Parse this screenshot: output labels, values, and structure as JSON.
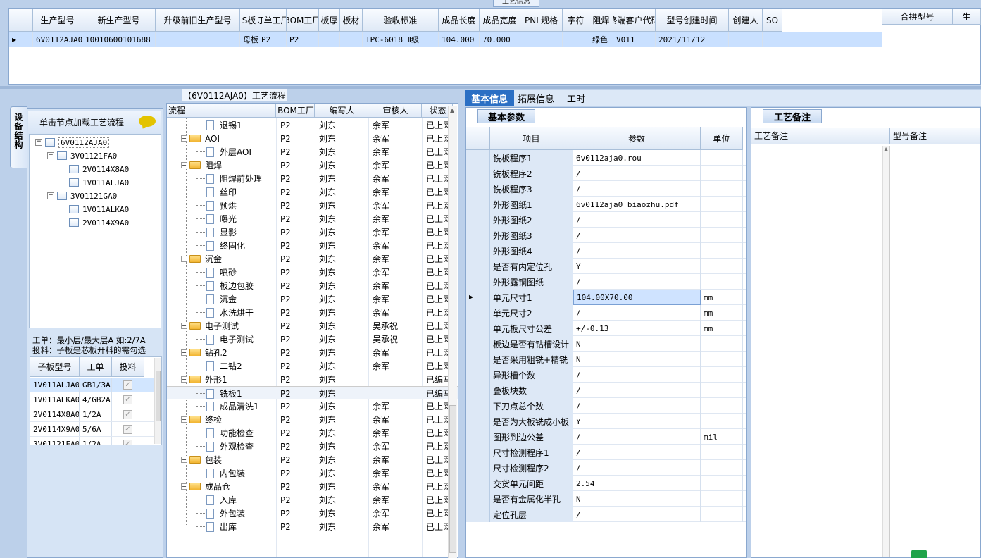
{
  "top_caption": "工艺信息",
  "top_grid": {
    "columns": [
      "生产型号",
      "新生产型号",
      "升级前旧生产型号",
      "S板",
      "订单工厂",
      "BOM工厂",
      "板厚",
      "板材",
      "验收标准",
      "成品长度",
      "成品宽度",
      "PNL规格",
      "字符",
      "阻焊",
      "终端客户代码",
      "型号创建时间",
      "创建人",
      "SO"
    ],
    "row": [
      "6V0112AJA0",
      "10010600101688",
      "",
      "母板",
      "P2",
      "P2",
      "",
      "",
      "IPC-6018 Ⅱ级",
      "104.000",
      "70.000",
      "",
      "",
      "绿色",
      "V011",
      "2021/11/12",
      "",
      ""
    ],
    "merge_columns": [
      "合拼型号",
      "生"
    ]
  },
  "side_tab": "设备结构",
  "left": {
    "load_hint": "单击节点加载工艺流程",
    "tree": [
      {
        "label": "6V0112AJA0",
        "level": 0,
        "toggle": "−"
      },
      {
        "label": "3V01121FA0",
        "level": 1,
        "toggle": "−"
      },
      {
        "label": "2V0114X8A0",
        "level": 2,
        "toggle": ""
      },
      {
        "label": "1V011ALJA0",
        "level": 2,
        "toggle": ""
      },
      {
        "label": "3V01121GA0",
        "level": 1,
        "toggle": "−"
      },
      {
        "label": "1V011ALKA0",
        "level": 2,
        "toggle": ""
      },
      {
        "label": "2V0114X9A0",
        "level": 2,
        "toggle": ""
      }
    ],
    "note_line1": "工单：最小层/最大层A 如:2/7A",
    "note_line2": "投料：子板是芯板开料的需勾选",
    "sub_grid": {
      "columns": [
        "子板型号",
        "工单",
        "投料"
      ],
      "rows": [
        [
          "1V011ALJA0",
          "GB1/3A",
          "✓"
        ],
        [
          "1V011ALKA0",
          "4/GB2A",
          "✓"
        ],
        [
          "2V0114X8A0",
          "1/2A",
          "✓"
        ],
        [
          "2V0114X9A0",
          "5/6A",
          "✓"
        ],
        [
          "3V01121FA0",
          "1/2A",
          "✓"
        ]
      ]
    }
  },
  "flow": {
    "title": "【6V0112AJA0】工艺流程",
    "columns": [
      "流程",
      "BOM工厂",
      "编写人",
      "审核人",
      "状态"
    ],
    "rows": [
      {
        "label": "退锡1",
        "level": 1,
        "factory": "P2",
        "writer": "刘东",
        "auditor": "余军",
        "status": "已上网"
      },
      {
        "label": "AOI",
        "level": 0,
        "factory": "P2",
        "writer": "刘东",
        "auditor": "余军",
        "status": "已上网"
      },
      {
        "label": "外层AOI",
        "level": 1,
        "factory": "P2",
        "writer": "刘东",
        "auditor": "余军",
        "status": "已上网"
      },
      {
        "label": "阻焊",
        "level": 0,
        "factory": "P2",
        "writer": "刘东",
        "auditor": "余军",
        "status": "已上网"
      },
      {
        "label": "阻焊前处理",
        "level": 1,
        "factory": "P2",
        "writer": "刘东",
        "auditor": "余军",
        "status": "已上网"
      },
      {
        "label": "丝印",
        "level": 1,
        "factory": "P2",
        "writer": "刘东",
        "auditor": "余军",
        "status": "已上网"
      },
      {
        "label": "预烘",
        "level": 1,
        "factory": "P2",
        "writer": "刘东",
        "auditor": "余军",
        "status": "已上网"
      },
      {
        "label": "曝光",
        "level": 1,
        "factory": "P2",
        "writer": "刘东",
        "auditor": "余军",
        "status": "已上网"
      },
      {
        "label": "显影",
        "level": 1,
        "factory": "P2",
        "writer": "刘东",
        "auditor": "余军",
        "status": "已上网"
      },
      {
        "label": "终固化",
        "level": 1,
        "factory": "P2",
        "writer": "刘东",
        "auditor": "余军",
        "status": "已上网"
      },
      {
        "label": "沉金",
        "level": 0,
        "factory": "P2",
        "writer": "刘东",
        "auditor": "余军",
        "status": "已上网"
      },
      {
        "label": "喷砂",
        "level": 1,
        "factory": "P2",
        "writer": "刘东",
        "auditor": "余军",
        "status": "已上网"
      },
      {
        "label": "板边包胶",
        "level": 1,
        "factory": "P2",
        "writer": "刘东",
        "auditor": "余军",
        "status": "已上网"
      },
      {
        "label": "沉金",
        "level": 1,
        "factory": "P2",
        "writer": "刘东",
        "auditor": "余军",
        "status": "已上网"
      },
      {
        "label": "水洗烘干",
        "level": 1,
        "factory": "P2",
        "writer": "刘东",
        "auditor": "余军",
        "status": "已上网"
      },
      {
        "label": "电子测试",
        "level": 0,
        "factory": "P2",
        "writer": "刘东",
        "auditor": "吴承祝",
        "status": "已上网"
      },
      {
        "label": "电子测试",
        "level": 1,
        "factory": "P2",
        "writer": "刘东",
        "auditor": "吴承祝",
        "status": "已上网"
      },
      {
        "label": "钻孔2",
        "level": 0,
        "factory": "P2",
        "writer": "刘东",
        "auditor": "余军",
        "status": "已上网"
      },
      {
        "label": "二钻2",
        "level": 1,
        "factory": "P2",
        "writer": "刘东",
        "auditor": "余军",
        "status": "已上网"
      },
      {
        "label": "外形1",
        "level": 0,
        "factory": "P2",
        "writer": "刘东",
        "auditor": "",
        "status": "已编写"
      },
      {
        "label": "铣板1",
        "level": 1,
        "factory": "P2",
        "writer": "刘东",
        "auditor": "",
        "status": "已编写"
      },
      {
        "label": "成品清洗1",
        "level": 1,
        "factory": "P2",
        "writer": "刘东",
        "auditor": "余军",
        "status": "已上网"
      },
      {
        "label": "终检",
        "level": 0,
        "factory": "P2",
        "writer": "刘东",
        "auditor": "余军",
        "status": "已上网"
      },
      {
        "label": "功能检查",
        "level": 1,
        "factory": "P2",
        "writer": "刘东",
        "auditor": "余军",
        "status": "已上网"
      },
      {
        "label": "外观检查",
        "level": 1,
        "factory": "P2",
        "writer": "刘东",
        "auditor": "余军",
        "status": "已上网"
      },
      {
        "label": "包装",
        "level": 0,
        "factory": "P2",
        "writer": "刘东",
        "auditor": "余军",
        "status": "已上网"
      },
      {
        "label": "内包装",
        "level": 1,
        "factory": "P2",
        "writer": "刘东",
        "auditor": "余军",
        "status": "已上网"
      },
      {
        "label": "成品仓",
        "level": 0,
        "factory": "P2",
        "writer": "刘东",
        "auditor": "余军",
        "status": "已上网"
      },
      {
        "label": "入库",
        "level": 1,
        "factory": "P2",
        "writer": "刘东",
        "auditor": "余军",
        "status": "已上网"
      },
      {
        "label": "外包装",
        "level": 1,
        "factory": "P2",
        "writer": "刘东",
        "auditor": "余军",
        "status": "已上网"
      },
      {
        "label": "出库",
        "level": 1,
        "factory": "P2",
        "writer": "刘东",
        "auditor": "余军",
        "status": "已上网"
      }
    ]
  },
  "tabs": [
    "基本信息",
    "拓展信息",
    "工时"
  ],
  "basic": {
    "tab": "基本参数",
    "columns": [
      "项目",
      "参数",
      "单位"
    ],
    "rows": [
      [
        "铣板程序1",
        "6v0112aja0.rou",
        ""
      ],
      [
        "铣板程序2",
        "/",
        ""
      ],
      [
        "铣板程序3",
        "/",
        ""
      ],
      [
        "外形图纸1",
        "6v0112aja0_biaozhu.pdf",
        ""
      ],
      [
        "外形图纸2",
        "/",
        ""
      ],
      [
        "外形图纸3",
        "/",
        ""
      ],
      [
        "外形图纸4",
        "/",
        ""
      ],
      [
        "是否有内定位孔",
        "Y",
        ""
      ],
      [
        "外形露铜图纸",
        "/",
        ""
      ],
      [
        "单元尺寸1",
        "104.00X70.00",
        "mm"
      ],
      [
        "单元尺寸2",
        "/",
        "mm"
      ],
      [
        "单元板尺寸公差",
        "+/-0.13",
        "mm"
      ],
      [
        "板边是否有钻槽设计",
        "N",
        ""
      ],
      [
        "是否采用粗铣+精铣",
        "N",
        ""
      ],
      [
        "异形槽个数",
        "/",
        ""
      ],
      [
        "叠板块数",
        "/",
        ""
      ],
      [
        "下刀点总个数",
        "/",
        ""
      ],
      [
        "是否为大板铣成小板",
        "Y",
        ""
      ],
      [
        "图形到边公差",
        "/",
        "mil"
      ],
      [
        "尺寸检测程序1",
        "/",
        ""
      ],
      [
        "尺寸检测程序2",
        "/",
        ""
      ],
      [
        "交货单元间距",
        "2.54",
        ""
      ],
      [
        "是否有金属化半孔",
        "N",
        ""
      ],
      [
        "定位孔层",
        "/",
        ""
      ]
    ]
  },
  "remark": {
    "tab": "工艺备注",
    "col1": "工艺备注",
    "col2": "型号备注"
  }
}
